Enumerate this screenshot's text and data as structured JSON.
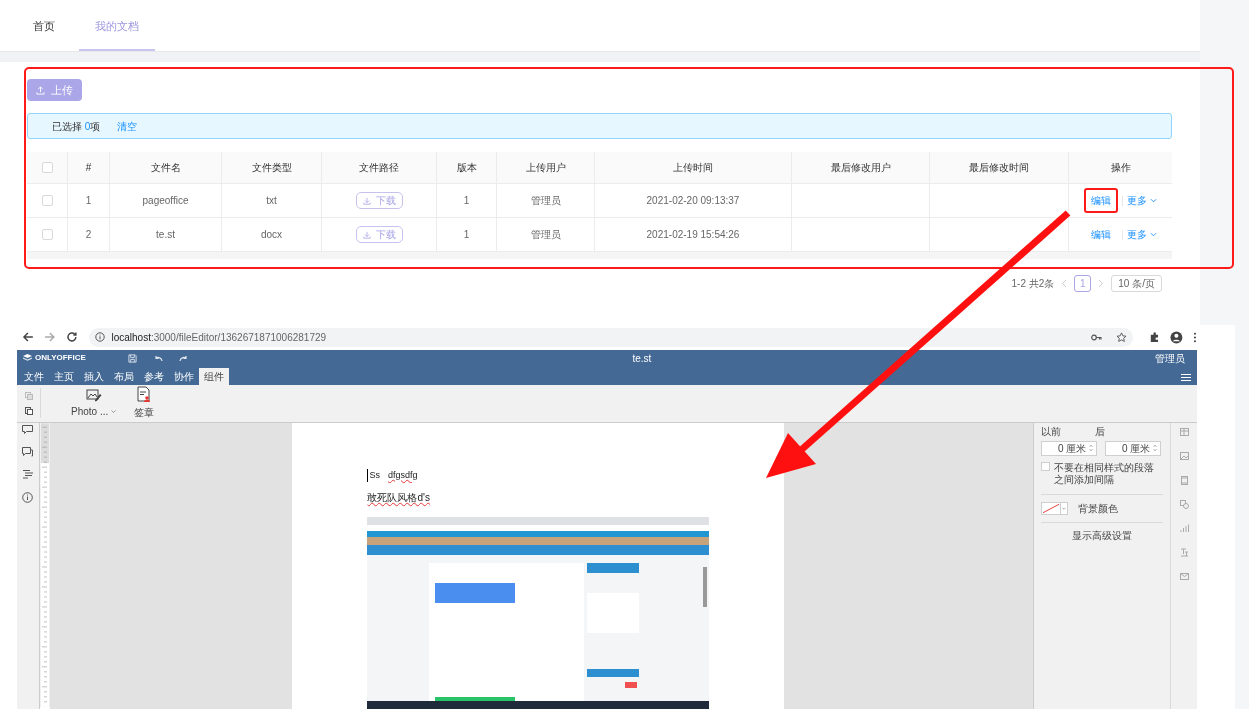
{
  "app": {
    "tabs": [
      {
        "label": "首页",
        "selected": false
      },
      {
        "label": "我的文档",
        "selected": true
      }
    ],
    "upload_button": "上传",
    "selection_bar": {
      "prefix": "已选择 ",
      "count": "0",
      "suffix": "项",
      "clear_link": "清空"
    },
    "table": {
      "select_all": {
        "checked": false
      },
      "columns": [
        "#",
        "文件名",
        "文件类型",
        "文件路径",
        "版本",
        "上传用户",
        "上传时间",
        "最后修改用户",
        "最后修改时间",
        "操作"
      ],
      "rows": [
        {
          "checked": false,
          "index": "1",
          "name": "pageoffice",
          "type": "txt",
          "path_button": "下载",
          "version": "1",
          "uploader": "管理员",
          "upload_time": "2021-02-20 09:13:37",
          "edit_link": "编辑",
          "more_link": "更多",
          "highlighted": true
        },
        {
          "checked": false,
          "index": "2",
          "name": "te.st",
          "type": "docx",
          "path_button": "下载",
          "version": "1",
          "uploader": "管理员",
          "upload_time": "2021-02-19 15:54:26",
          "edit_link": "编辑",
          "more_link": "更多",
          "highlighted": false
        }
      ]
    },
    "pagination": {
      "range": "1-2 共2条",
      "pages": [
        {
          "label": "1",
          "selected": true
        }
      ],
      "page_size": "10 条/页"
    }
  },
  "browser": {
    "url_host": "localhost",
    "url_path": ":3000/fileEditor/1362671871006281729"
  },
  "editor": {
    "logo": "ONLYOFFICE",
    "title": "te.st",
    "user": "管理员",
    "menu_tabs": [
      {
        "label": "文件",
        "selected": false
      },
      {
        "label": "主页",
        "selected": false
      },
      {
        "label": "插入",
        "selected": false
      },
      {
        "label": "布局",
        "selected": false
      },
      {
        "label": "参考",
        "selected": false
      },
      {
        "label": "协作",
        "selected": false
      },
      {
        "label": "组件",
        "selected": true
      }
    ],
    "toolbar": [
      {
        "label": "Photo ..."
      },
      {
        "label": "签章",
        "kind": "seal"
      }
    ],
    "document": {
      "lines": [
        {
          "words": [
            "Ss",
            "dfgsdfg"
          ]
        },
        {
          "words": [
            "敢死队风格d's"
          ]
        }
      ]
    },
    "paragraph_panel": {
      "before_label": "以前",
      "after_label": "后",
      "before_value": "0 厘米",
      "after_value": "0 厘米",
      "no_space_checkbox": {
        "label": "不要在相同样式的段落之间添加间隔",
        "checked": false
      },
      "background_label": "背景颜色",
      "advanced_link": "显示高级设置"
    }
  }
}
